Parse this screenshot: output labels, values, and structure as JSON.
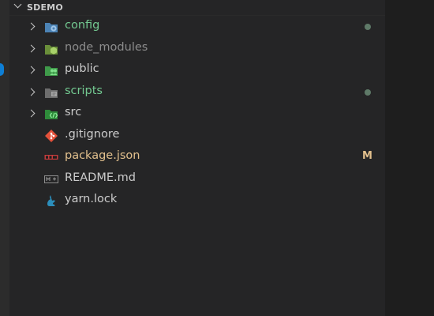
{
  "explorer": {
    "title": "SDEMO",
    "items": [
      {
        "label": "config",
        "type": "folder",
        "color": "#73c991",
        "decoration": "dot",
        "decoration_color": "#5f7a68"
      },
      {
        "label": "node_modules",
        "type": "folder",
        "color": "#8c8c8c",
        "decoration": "",
        "decoration_color": ""
      },
      {
        "label": "public",
        "type": "folder",
        "color": "#cccccc",
        "decoration": "",
        "decoration_color": ""
      },
      {
        "label": "scripts",
        "type": "folder",
        "color": "#73c991",
        "decoration": "dot",
        "decoration_color": "#5f7a68"
      },
      {
        "label": "src",
        "type": "folder",
        "color": "#cccccc",
        "decoration": "",
        "decoration_color": ""
      },
      {
        "label": ".gitignore",
        "type": "file",
        "color": "#cccccc",
        "decoration": "",
        "decoration_color": ""
      },
      {
        "label": "package.json",
        "type": "file",
        "color": "#e2c08d",
        "decoration": "M",
        "decoration_color": "#e2c08d"
      },
      {
        "label": "README.md",
        "type": "file",
        "color": "#cccccc",
        "decoration": "",
        "decoration_color": ""
      },
      {
        "label": "yarn.lock",
        "type": "file",
        "color": "#cccccc",
        "decoration": "",
        "decoration_color": ""
      }
    ]
  },
  "icons": {
    "section_chevron": "chevron-down-icon",
    "folder_chevron": "chevron-right-icon",
    "config": "config-folder-icon",
    "node_modules": "node-folder-icon",
    "public": "public-folder-icon",
    "scripts": "scripts-folder-icon",
    "src": "src-folder-icon",
    "gitignore": "git-icon",
    "package_json": "npm-icon",
    "readme": "markdown-icon",
    "yarn_lock": "yarn-icon"
  },
  "colors": {
    "sidebar_bg": "#252526",
    "editor_bg": "#1e1e1e",
    "modified": "#e2c08d",
    "untracked": "#73c991",
    "accent": "#0e7fd6"
  }
}
